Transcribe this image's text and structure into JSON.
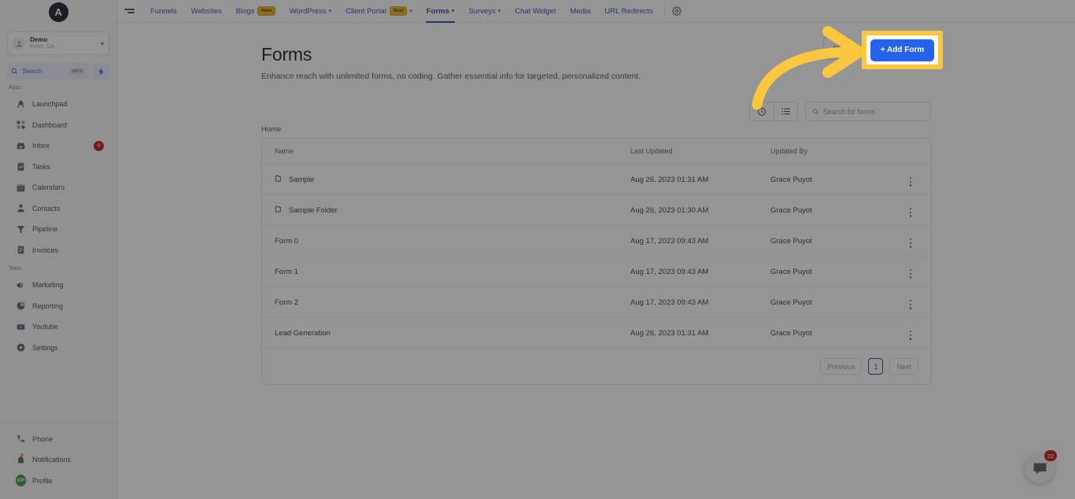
{
  "brand": {
    "logo_letter": "A",
    "accent_blue": "#2563eb",
    "highlight_yellow": "#fbc73f",
    "badge_red": "#c4171a"
  },
  "sidebar": {
    "location": {
      "name": "Demo",
      "sub": "Irvine, CA"
    },
    "search": {
      "label": "Search",
      "shortcut": "ctrl K"
    },
    "section_apps": "Apps",
    "section_tools": "Tools",
    "apps": [
      {
        "label": "Launchpad",
        "icon": "rocket-icon",
        "badge": ""
      },
      {
        "label": "Dashboard",
        "icon": "grid-icon",
        "badge": ""
      },
      {
        "label": "Inbox",
        "icon": "inbox-icon",
        "badge": "0"
      },
      {
        "label": "Tasks",
        "icon": "clipboard-check-icon",
        "badge": ""
      },
      {
        "label": "Calendars",
        "icon": "calendar-icon",
        "badge": ""
      },
      {
        "label": "Contacts",
        "icon": "person-icon",
        "badge": ""
      },
      {
        "label": "Pipeline",
        "icon": "funnel-icon",
        "badge": ""
      },
      {
        "label": "Invoices",
        "icon": "document-lines-icon",
        "badge": ""
      }
    ],
    "tools": [
      {
        "label": "Marketing",
        "icon": "megaphone-icon",
        "badge": ""
      },
      {
        "label": "Reporting",
        "icon": "pie-chart-icon",
        "badge": ""
      },
      {
        "label": "Youtube",
        "icon": "video-icon",
        "badge": ""
      },
      {
        "label": "Settings",
        "icon": "gear-icon",
        "badge": ""
      }
    ],
    "bottom": [
      {
        "label": "Phone",
        "icon": "phone-icon"
      },
      {
        "label": "Notifications",
        "icon": "bell-icon"
      },
      {
        "label": "Profile",
        "icon": "avatar",
        "initials": "GP"
      }
    ]
  },
  "topnav": {
    "items": [
      {
        "label": "Funnels",
        "badge": "",
        "caret": false,
        "active": false
      },
      {
        "label": "Websites",
        "badge": "",
        "caret": false,
        "active": false
      },
      {
        "label": "Blogs",
        "badge": "New",
        "caret": false,
        "active": false
      },
      {
        "label": "WordPress",
        "badge": "",
        "caret": true,
        "active": false
      },
      {
        "label": "Client Portal",
        "badge": "New",
        "caret": true,
        "active": false
      },
      {
        "label": "Forms",
        "badge": "",
        "caret": true,
        "active": true
      },
      {
        "label": "Surveys",
        "badge": "",
        "caret": true,
        "active": false
      },
      {
        "label": "Chat Widget",
        "badge": "",
        "caret": false,
        "active": false
      },
      {
        "label": "Media",
        "badge": "",
        "caret": false,
        "active": false
      },
      {
        "label": "URL Redirects",
        "badge": "",
        "caret": false,
        "active": false
      }
    ],
    "settings_icon": "gear-icon",
    "menu_icon": "hamburger-icon"
  },
  "page": {
    "title": "Forms",
    "subtitle": "Enhance reach with unlimited forms, no coding. Gather essential info for targeted, personalized content.",
    "add_folder_label": "er",
    "add_form_label": "+  Add Form",
    "breadcrumb": "Home"
  },
  "toolbar": {
    "recent_icon": "clock-icon",
    "list_icon": "list-icon",
    "search_placeholder": "Search for forms",
    "search_value": "",
    "search_icon": "search-icon"
  },
  "table": {
    "columns": [
      "Name",
      "Last Updated",
      "Updated By",
      ""
    ],
    "rows": [
      {
        "name": "Sample",
        "is_folder": true,
        "updated": "Aug 26, 2023 01:31 AM",
        "by": "Grace Puyot"
      },
      {
        "name": "Sample Folder",
        "is_folder": true,
        "updated": "Aug 26, 2023 01:30 AM",
        "by": "Grace Puyot"
      },
      {
        "name": "Form 0",
        "is_folder": false,
        "updated": "Aug 17, 2023 09:43 AM",
        "by": "Grace Puyot"
      },
      {
        "name": "Form 1",
        "is_folder": false,
        "updated": "Aug 17, 2023 09:43 AM",
        "by": "Grace Puyot"
      },
      {
        "name": "Form 2",
        "is_folder": false,
        "updated": "Aug 17, 2023 09:43 AM",
        "by": "Grace Puyot"
      },
      {
        "name": "Lead Generation",
        "is_folder": false,
        "updated": "Aug 26, 2023 01:31 AM",
        "by": "Grace Puyot"
      }
    ]
  },
  "pagination": {
    "previous": "Previous",
    "current": "1",
    "next": "Next"
  },
  "chat": {
    "badge": "22",
    "icon": "chat-bubble-icon"
  }
}
